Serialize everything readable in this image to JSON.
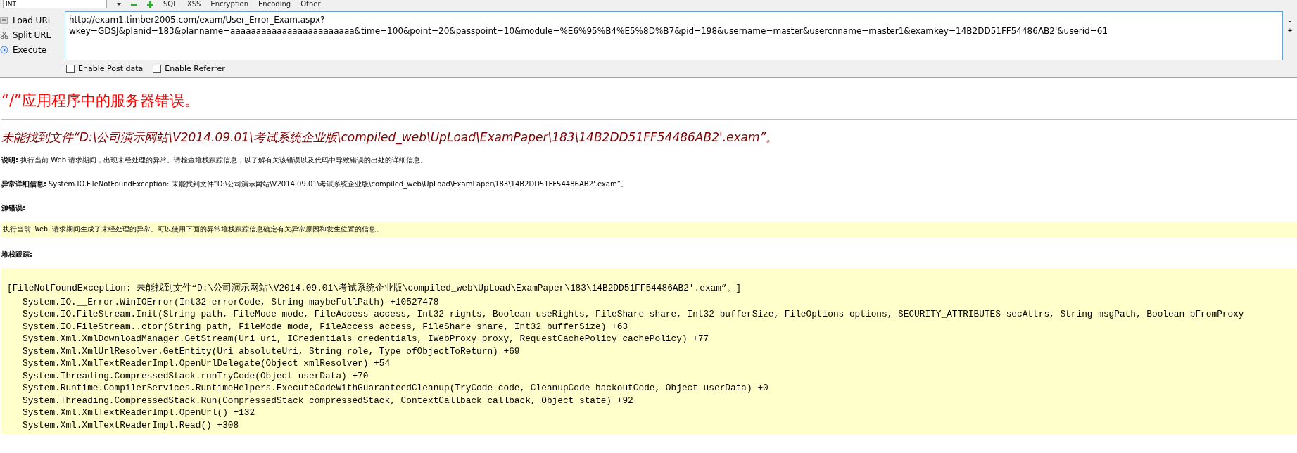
{
  "toolbar": {
    "dropdown": "INT",
    "menus": [
      "SQL",
      "XSS",
      "Encryption",
      "Encoding",
      "Other"
    ]
  },
  "side_buttons": [
    {
      "kind": "load",
      "label": "Load URL"
    },
    {
      "kind": "split",
      "label": "Split URL"
    },
    {
      "kind": "execute",
      "label": "Execute"
    }
  ],
  "url_field": {
    "value": "http://exam1.timber2005.com/exam/User_Error_Exam.aspx?wkey=GDSJ&planid=183&planname=aaaaaaaaaaaaaaaaaaaaaaaa&time=100&point=20&passpoint=10&module=%E6%95%B4%E5%8D%B7&pid=198&username=master&usercnname=master1&examkey=14B2DD51FF54486AB2'&userid=61"
  },
  "edge_buttons": [
    "-",
    "+"
  ],
  "options": [
    {
      "label": "Enable Post data",
      "checked": false
    },
    {
      "label": "Enable Referrer",
      "checked": false
    }
  ],
  "error_page": {
    "title": "“/”应用程序中的服务器错误。",
    "message": "未能找到文件“D:\\公司演示网站\\V2014.09.01\\考试系统企业版\\compiled_web\\UpLoad\\ExamPaper\\183\\14B2DD51FF54486AB2'.exam”。",
    "description": {
      "label": "说明:",
      "text": "执行当前 Web 请求期间，出现未经处理的异常。请检查堆栈跟踪信息，以了解有关该错误以及代码中导致错误的出处的详细信息。"
    },
    "exception": {
      "label": "异常详细信息:",
      "text": "System.IO.FileNotFoundException: 未能找到文件“D:\\公司演示网站\\V2014.09.01\\考试系统企业版\\compiled_web\\UpLoad\\ExamPaper\\183\\14B2DD51FF54486AB2'.exam”。"
    },
    "source_label": "源错误:",
    "source_text": "执行当前 Web 请求期间生成了未经处理的异常。可以使用下面的异常堆栈跟踪信息确定有关异常原因和发生位置的信息。",
    "stack_label": "堆栈跟踪:",
    "stack_lines": [
      {
        "kind": "exception",
        "text": "[FileNotFoundException: 未能找到文件“D:\\公司演示网站\\V2014.09.01\\考试系统企业版\\compiled_web\\UpLoad\\ExamPaper\\183\\14B2DD51FF54486AB2'.exam”。]"
      },
      {
        "kind": "frame",
        "text": "System.IO.__Error.WinIOError(Int32 errorCode, String maybeFullPath) +10527478"
      },
      {
        "kind": "frame",
        "text": "System.IO.FileStream.Init(String path, FileMode mode, FileAccess access, Int32 rights, Boolean useRights, FileShare share, Int32 bufferSize, FileOptions options, SECURITY_ATTRIBUTES secAttrs, String msgPath, Boolean bFromProxy"
      },
      {
        "kind": "frame",
        "text": "System.IO.FileStream..ctor(String path, FileMode mode, FileAccess access, FileShare share, Int32 bufferSize) +63"
      },
      {
        "kind": "frame",
        "text": "System.Xml.XmlDownloadManager.GetStream(Uri uri, ICredentials credentials, IWebProxy proxy, RequestCachePolicy cachePolicy) +77"
      },
      {
        "kind": "frame",
        "text": "System.Xml.XmlUrlResolver.GetEntity(Uri absoluteUri, String role, Type ofObjectToReturn) +69"
      },
      {
        "kind": "frame",
        "text": "System.Xml.XmlTextReaderImpl.OpenUrlDelegate(Object xmlResolver) +54"
      },
      {
        "kind": "frame",
        "text": "System.Threading.CompressedStack.runTryCode(Object userData) +70"
      },
      {
        "kind": "frame",
        "text": "System.Runtime.CompilerServices.RuntimeHelpers.ExecuteCodeWithGuaranteedCleanup(TryCode code, CleanupCode backoutCode, Object userData) +0"
      },
      {
        "kind": "frame",
        "text": "System.Threading.CompressedStack.Run(CompressedStack compressedStack, ContextCallback callback, Object state) +92"
      },
      {
        "kind": "frame",
        "text": "System.Xml.XmlTextReaderImpl.OpenUrl() +132"
      },
      {
        "kind": "frame",
        "text": "System.Xml.XmlTextReaderImpl.Read() +308"
      }
    ]
  }
}
